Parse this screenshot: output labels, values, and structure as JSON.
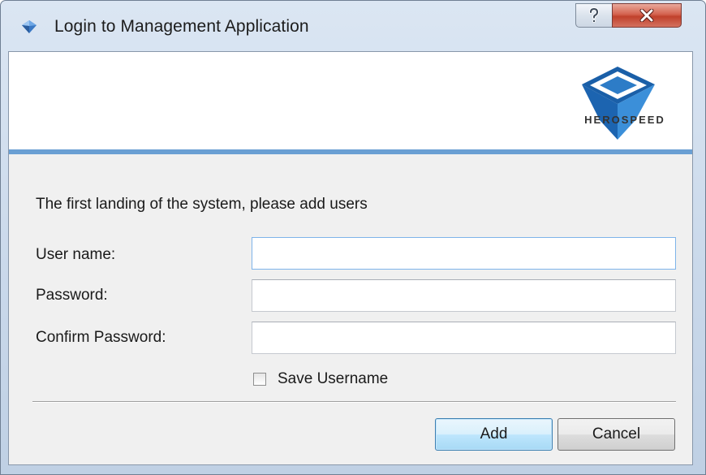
{
  "window": {
    "title": "Login to Management Application"
  },
  "titlebar": {
    "help_symbol": "?",
    "close_symbol": "x"
  },
  "banner": {
    "logo_text": "HEROSPEED",
    "accent_color": "#6a9fd3"
  },
  "form": {
    "instruction": "The first landing of the system, please add users",
    "username_label": "User name:",
    "username_value": "",
    "password_label": "Password:",
    "password_value": "",
    "confirm_label": "Confirm Password:",
    "confirm_value": "",
    "save_username_label": "Save Username",
    "save_username_checked": false
  },
  "actions": {
    "add_label": "Add",
    "cancel_label": "Cancel"
  },
  "icons": {
    "app": "diamond-app-icon",
    "help": "help-icon",
    "close": "close-icon",
    "logo": "herospeed-logo"
  }
}
